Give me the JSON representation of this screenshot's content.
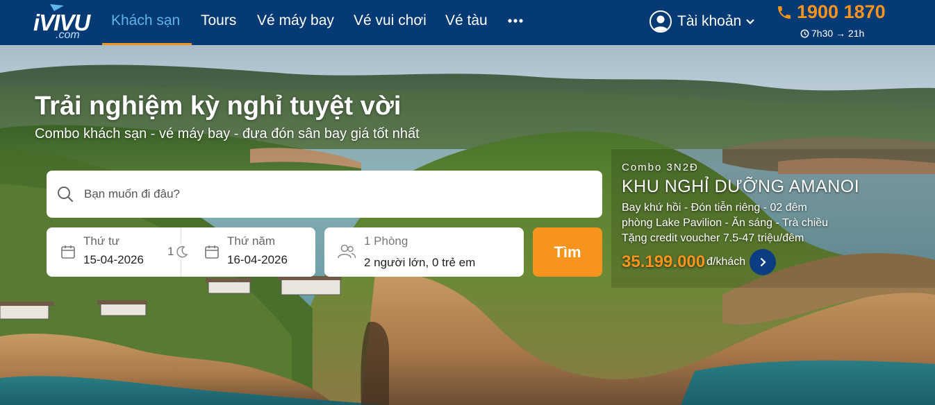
{
  "brand": {
    "name": "iVIVU",
    "suffix": ".com"
  },
  "nav": {
    "items": [
      {
        "label": "Khách sạn",
        "active": true
      },
      {
        "label": "Tours"
      },
      {
        "label": "Vé máy bay"
      },
      {
        "label": "Vé vui chơi"
      },
      {
        "label": "Vé tàu"
      }
    ],
    "more_icon": "ellipsis-icon",
    "account_label": "Tài khoản",
    "hotline": "1900 1870",
    "hours": "7h30 → 21h"
  },
  "hero": {
    "title": "Trải nghiệm kỳ nghỉ tuyệt vời",
    "subtitle": "Combo khách sạn - vé máy bay - đưa đón sân bay giá tốt nhất"
  },
  "search": {
    "placeholder": "Bạn muốn đi đâu?",
    "checkin_label": "Thứ tư",
    "checkin_date": "15-04-2026",
    "checkout_label": "Thứ năm",
    "checkout_date": "16-04-2026",
    "nights": "1",
    "rooms": "1 Phòng",
    "guests": "2 người lớn, 0 trẻ em",
    "button_label": "Tìm"
  },
  "promo": {
    "tag": "Combo 3N2Đ",
    "name": "KHU NGHỈ DƯỠNG AMANOI",
    "lines": [
      "Bay khứ hồi - Đón tiễn riêng - 02 đêm",
      "phòng Lake Pavilion - Ăn sáng - Trà chiều",
      "Tặng credit voucher 7.5-47 triệu/đêm"
    ],
    "price": "35.199.000",
    "price_unit": "đ/khách"
  },
  "colors": {
    "nav_bg": "#053a75",
    "accent_orange": "#f7941d",
    "active_blue": "#5fb4ea",
    "promo_button": "#0c3d82"
  }
}
